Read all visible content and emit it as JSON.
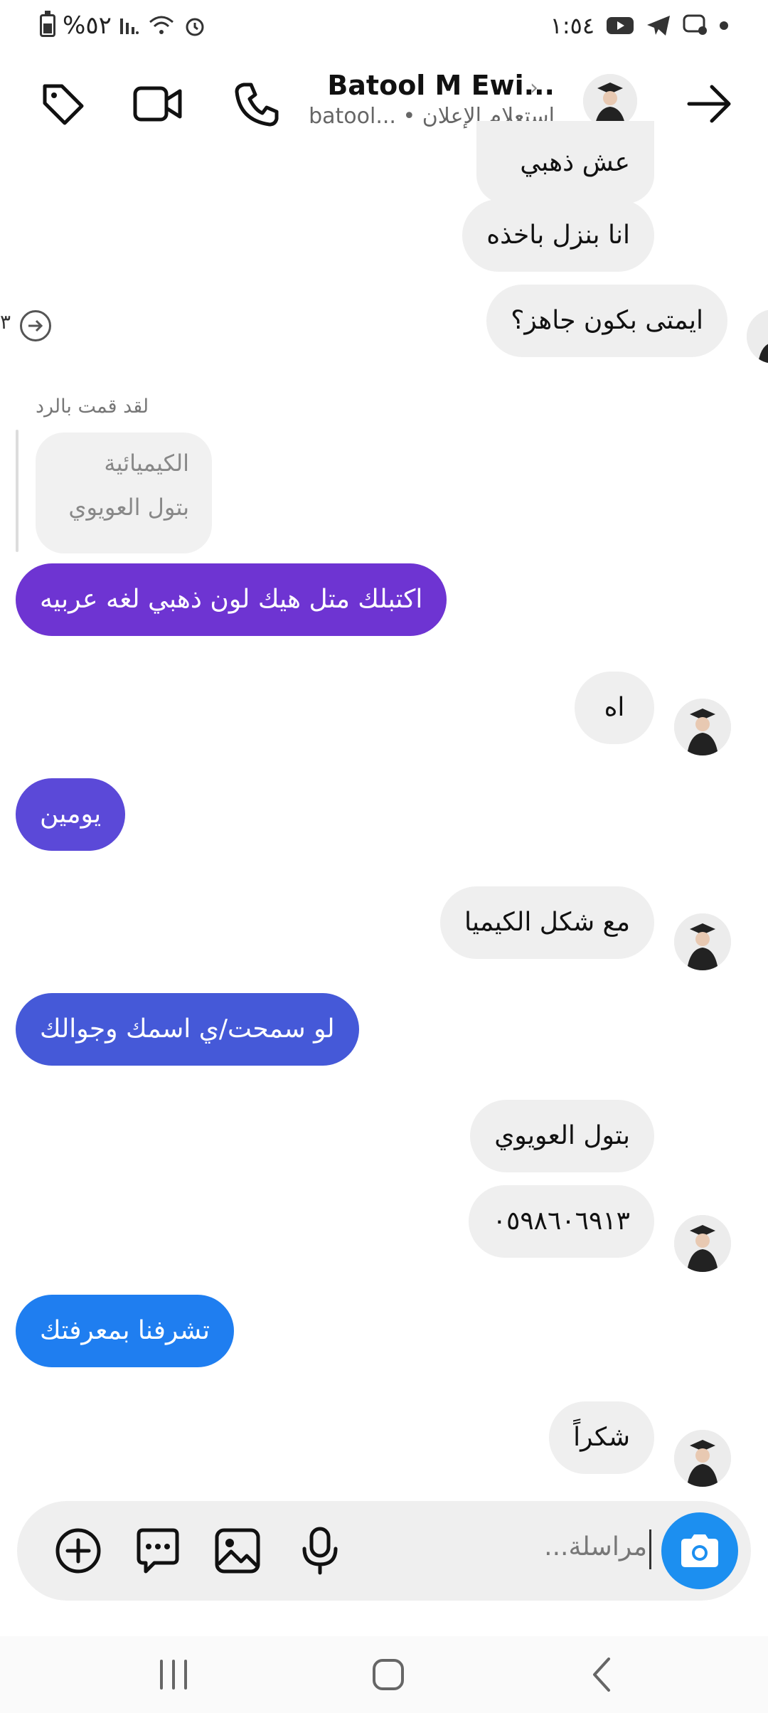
{
  "status_bar": {
    "battery": "%٥٢",
    "time": "١:٥٤"
  },
  "header": {
    "title": "Batool M Ewi...",
    "subtitle": "batool... • استعلام الإعلان"
  },
  "messages": {
    "m0": "عش ذهبي",
    "m1": "انا بنزل باخذه",
    "m2": "ايمتى بكون جاهز؟",
    "m2_count": "٣",
    "reply_label": "لقد قمت بالرد",
    "quoted_line1": "الكيميائية",
    "quoted_line2": "بتول العويوي",
    "m3": "اكتبلك متل هيك لون ذهبي لغه عربيه",
    "m4": "اه",
    "m5": "يومين",
    "m6": "مع شكل الكيميا",
    "m7": "لو سمحت/ي اسمك وجوالك",
    "m8": "بتول العويوي",
    "m9": "٠٥٩٨٦٠٦٩١٣",
    "m10": "تشرفنا بمعرفتك",
    "m11": "شكراً"
  },
  "composer": {
    "placeholder": "مراسلة..."
  },
  "colors": {
    "out_1": "#6e34d2",
    "out_2": "#5b49d8",
    "out_3": "#4559d8",
    "out_4": "#1f7ef0",
    "accent": "#1c8ff0"
  },
  "icons": [
    "tag-icon",
    "video-icon",
    "phone-icon",
    "chevron-right-icon",
    "back-arrow-icon",
    "plus-icon",
    "sticker-icon",
    "gallery-icon",
    "microphone-icon",
    "camera-icon",
    "recents-icon",
    "home-icon",
    "back-icon"
  ]
}
